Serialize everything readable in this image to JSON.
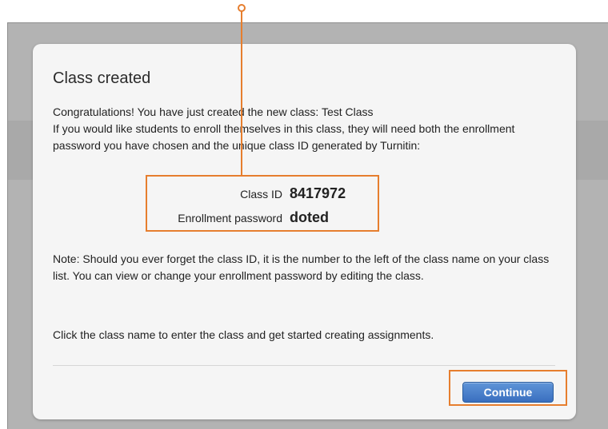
{
  "dialog": {
    "title": "Class created",
    "intro_line1": "Congratulations! You have just created the new class: Test Class",
    "intro_line2": "If you would like students to enroll themselves in this class, they will need both the enrollment password you have chosen and the unique class ID generated by Turnitin:",
    "class_id_label": "Class ID",
    "class_id_value": "8417972",
    "password_label": "Enrollment password",
    "password_value": "doted",
    "note": "Note: Should you ever forget the class ID, it is the number to the left of the class name on your class list. You can view or change your enrollment password by editing the class.",
    "hint": "Click the class name to enter the class and get started creating assignments.",
    "continue_label": "Continue"
  },
  "colors": {
    "highlight": "#e67e2e",
    "button": "#3a6fbf",
    "overlay": "#b3b3b3"
  }
}
